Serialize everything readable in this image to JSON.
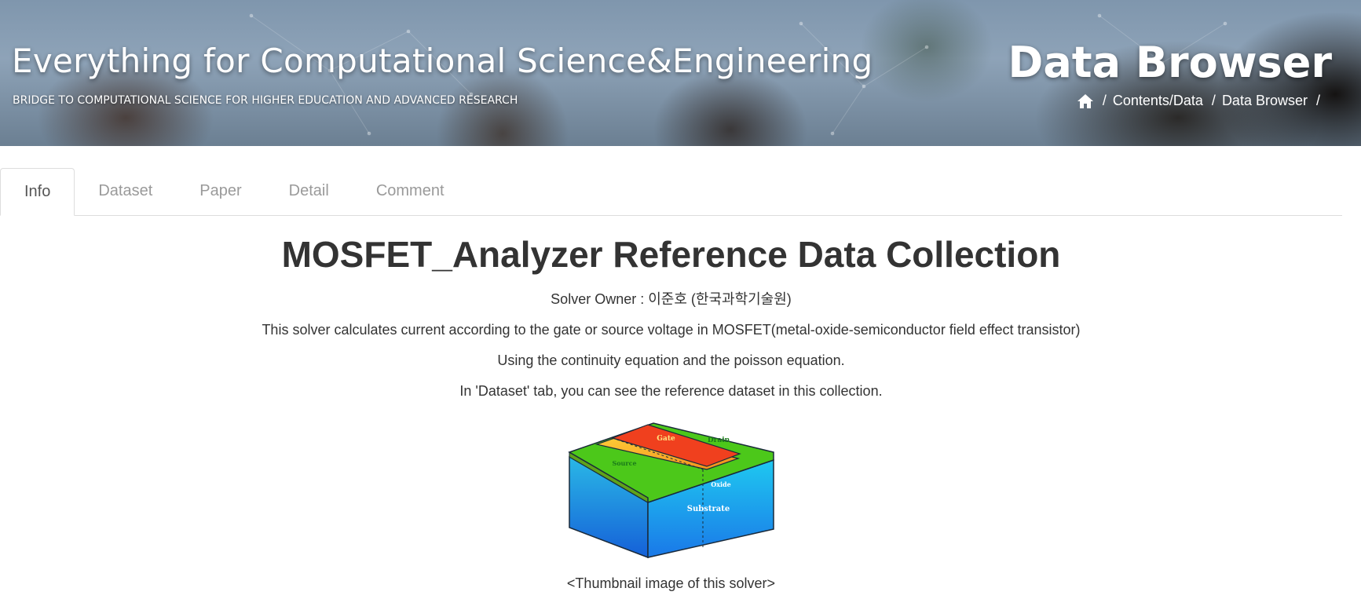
{
  "header": {
    "site_title": "Everything for Computational Science&Engineering",
    "site_subtitle": "BRIDGE TO COMPUTATIONAL SCIENCE FOR HIGHER EDUCATION AND ADVANCED RESEARCH",
    "page_heading": "Data Browser",
    "breadcrumb": {
      "home_icon": "home-icon",
      "separator": "/",
      "items": [
        "Contents/Data",
        "Data Browser"
      ]
    }
  },
  "tabs": {
    "active": "Info",
    "items": [
      "Info",
      "Dataset",
      "Paper",
      "Detail",
      "Comment"
    ]
  },
  "content": {
    "title": "MOSFET_Analyzer Reference Data Collection",
    "owner": "Solver Owner : 이준호 (한국과학기술원)",
    "description_1": "This solver calculates current according to the gate or source voltage in MOSFET(metal-oxide-semiconductor field effect transistor)",
    "description_2": "Using the continuity equation and the poisson equation.",
    "description_3": "In 'Dataset' tab, you can see the reference dataset in this collection.",
    "thumbnail": {
      "labels": {
        "gate": "Gate",
        "drain": "Drain",
        "source": "Source",
        "oxide": "Oxide",
        "substrate": "Substrate"
      },
      "caption": "<Thumbnail image of this solver>"
    }
  },
  "colors": {
    "tab_inactive": "#9a9a9a",
    "tab_active": "#555555",
    "text": "#333333",
    "substrate_top": "#2ab8e6",
    "substrate_bottom": "#1560d8",
    "source_drain": "#4cc81a",
    "gate": "#f0401e",
    "oxide": "#f5a623"
  }
}
